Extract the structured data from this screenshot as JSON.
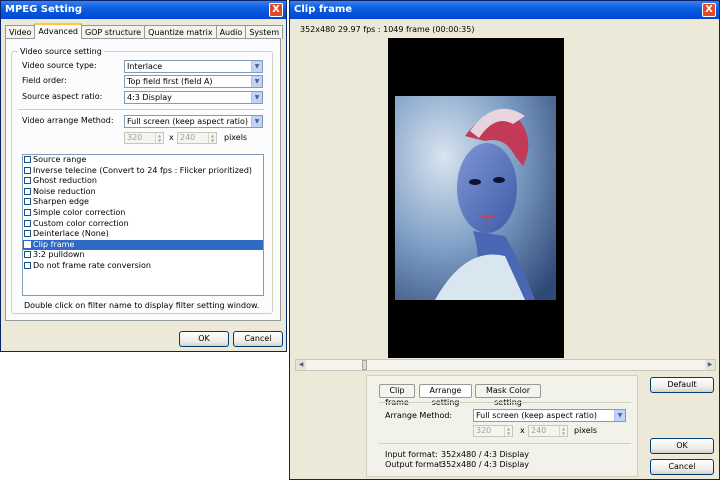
{
  "mpeg": {
    "title": "MPEG Setting",
    "close": "X",
    "tabs": [
      "Video",
      "Advanced",
      "GOP structure",
      "Quantize matrix",
      "Audio",
      "System"
    ],
    "group_label": "Video source setting",
    "source_type_label": "Video source type:",
    "source_type_value": "Interlace",
    "field_order_label": "Field order:",
    "field_order_value": "Top field first (field A)",
    "aspect_label": "Source aspect ratio:",
    "aspect_value": "4:3 Display",
    "arrange_label": "Video arrange Method:",
    "arrange_value": "Full screen (keep aspect ratio)",
    "width": "320",
    "height": "240",
    "x_sep": "x",
    "pixels": "pixels",
    "filters": [
      {
        "label": "Source range",
        "checked": false,
        "selected": false
      },
      {
        "label": "Inverse telecine (Convert to 24 fps : Flicker prioritized)",
        "checked": false,
        "selected": false
      },
      {
        "label": "Ghost reduction",
        "checked": false,
        "selected": false
      },
      {
        "label": "Noise reduction",
        "checked": false,
        "selected": false
      },
      {
        "label": "Sharpen edge",
        "checked": false,
        "selected": false
      },
      {
        "label": "Simple color correction",
        "checked": false,
        "selected": false
      },
      {
        "label": "Custom color correction",
        "checked": false,
        "selected": false
      },
      {
        "label": "Deinterlace (None)",
        "checked": false,
        "selected": false
      },
      {
        "label": "Clip frame",
        "checked": true,
        "selected": true
      },
      {
        "label": "3:2 pulldown",
        "checked": false,
        "selected": false
      },
      {
        "label": "Do not frame rate conversion",
        "checked": false,
        "selected": false
      }
    ],
    "hint": "Double click on filter name to display filter setting window.",
    "ok": "OK",
    "cancel": "Cancel"
  },
  "clip": {
    "title": "Clip frame",
    "close": "X",
    "info": "352x480 29.97 fps : 1049 frame (00:00:35)",
    "tabs": [
      "Clip frame",
      "Arrange setting",
      "Mask Color setting"
    ],
    "arrange_label": "Arrange Method:",
    "arrange_value": "Full screen (keep aspect ratio)",
    "width": "320",
    "height": "240",
    "x_sep": "x",
    "pixels": "pixels",
    "input_label": "Input format:",
    "input_value": "352x480 / 4:3 Display",
    "output_label": "Output format:",
    "output_value": "352x480 / 4:3 Display",
    "default": "Default",
    "ok": "OK",
    "cancel": "Cancel"
  }
}
